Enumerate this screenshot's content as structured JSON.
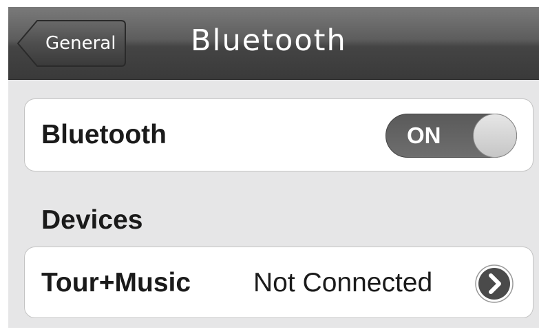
{
  "navbar": {
    "back_label": "General",
    "title": "Bluetooth"
  },
  "bluetooth_cell": {
    "label": "Bluetooth",
    "toggle": {
      "text": "ON",
      "state": "on"
    }
  },
  "devices_section": {
    "header": "Devices",
    "items": [
      {
        "name": "Tour+Music",
        "status": "Not Connected",
        "icon": "chevron-right-circle-icon"
      }
    ]
  },
  "colors": {
    "navbar": "#444444",
    "background": "#e6e6e7",
    "cell": "#ffffff",
    "toggle_on": "#5f5f5f"
  }
}
